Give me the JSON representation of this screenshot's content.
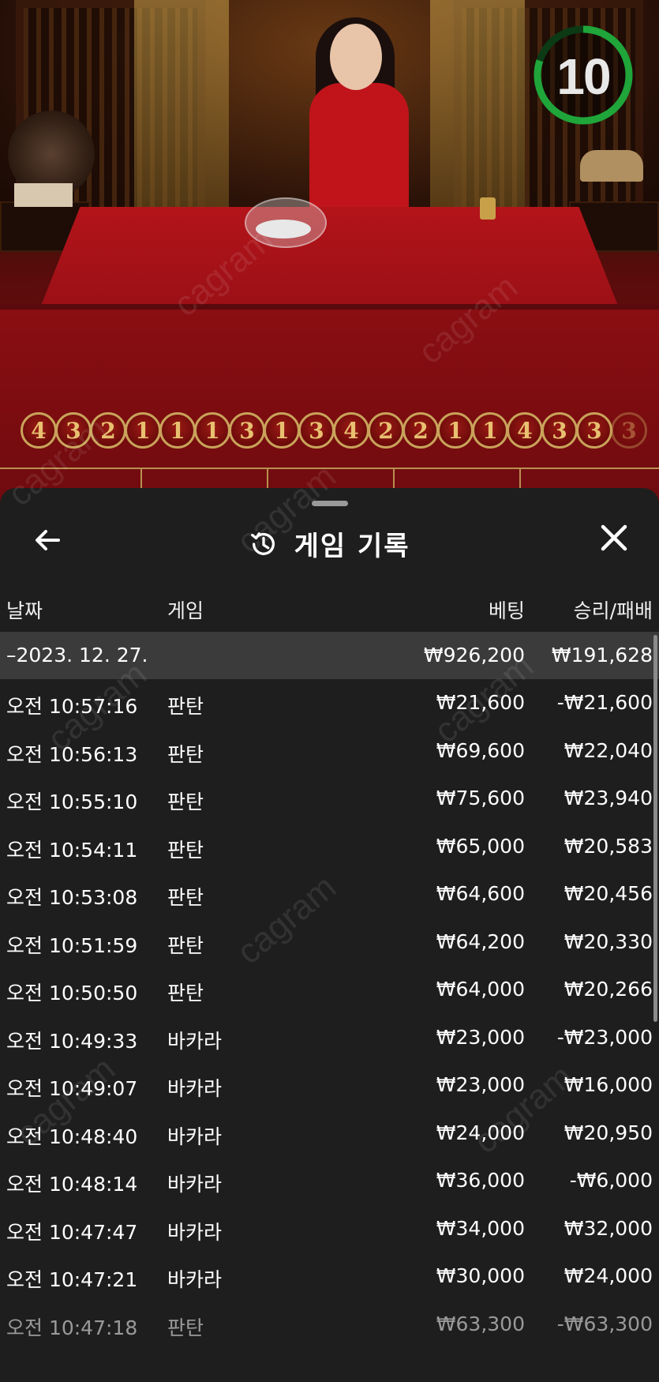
{
  "timer": {
    "value": "10",
    "progress": 0.8,
    "color": "#1fa53a"
  },
  "road": {
    "balls": [
      "4",
      "3",
      "2",
      "1",
      "1",
      "1",
      "3",
      "1",
      "3",
      "4",
      "2",
      "2",
      "1",
      "1",
      "4",
      "3",
      "3",
      "3"
    ]
  },
  "panel": {
    "title": "게임 기록",
    "back_icon": "arrow-left-icon",
    "close_icon": "close-icon",
    "history_icon": "history-clock-icon",
    "columns": {
      "date": "날짜",
      "game": "게임",
      "bet": "베팅",
      "win_loss": "승리/패배"
    },
    "group": {
      "date": "–2023. 12. 27.",
      "bet": "₩926,200",
      "win_loss": "₩191,628"
    },
    "rows": [
      {
        "time": "오전 10:57:16",
        "game": "판탄",
        "bet": "₩21,600",
        "win_loss": "-₩21,600"
      },
      {
        "time": "오전 10:56:13",
        "game": "판탄",
        "bet": "₩69,600",
        "win_loss": "₩22,040"
      },
      {
        "time": "오전 10:55:10",
        "game": "판탄",
        "bet": "₩75,600",
        "win_loss": "₩23,940"
      },
      {
        "time": "오전 10:54:11",
        "game": "판탄",
        "bet": "₩65,000",
        "win_loss": "₩20,583"
      },
      {
        "time": "오전 10:53:08",
        "game": "판탄",
        "bet": "₩64,600",
        "win_loss": "₩20,456"
      },
      {
        "time": "오전 10:51:59",
        "game": "판탄",
        "bet": "₩64,200",
        "win_loss": "₩20,330"
      },
      {
        "time": "오전 10:50:50",
        "game": "판탄",
        "bet": "₩64,000",
        "win_loss": "₩20,266"
      },
      {
        "time": "오전 10:49:33",
        "game": "바카라",
        "bet": "₩23,000",
        "win_loss": "-₩23,000"
      },
      {
        "time": "오전 10:49:07",
        "game": "바카라",
        "bet": "₩23,000",
        "win_loss": "₩16,000"
      },
      {
        "time": "오전 10:48:40",
        "game": "바카라",
        "bet": "₩24,000",
        "win_loss": "₩20,950"
      },
      {
        "time": "오전 10:48:14",
        "game": "바카라",
        "bet": "₩36,000",
        "win_loss": "-₩6,000"
      },
      {
        "time": "오전 10:47:47",
        "game": "바카라",
        "bet": "₩34,000",
        "win_loss": "₩32,000"
      },
      {
        "time": "오전 10:47:21",
        "game": "바카라",
        "bet": "₩30,000",
        "win_loss": "₩24,000"
      },
      {
        "time": "오전 10:47:18",
        "game": "판탄",
        "bet": "₩63,300",
        "win_loss": "-₩63,300"
      }
    ]
  },
  "watermark": "cagram",
  "colors": {
    "panel_bg": "#1e1e1e",
    "group_row_bg": "#3b3b3b",
    "accent_gold": "#c9a35a",
    "table_red": "#9a1016"
  }
}
